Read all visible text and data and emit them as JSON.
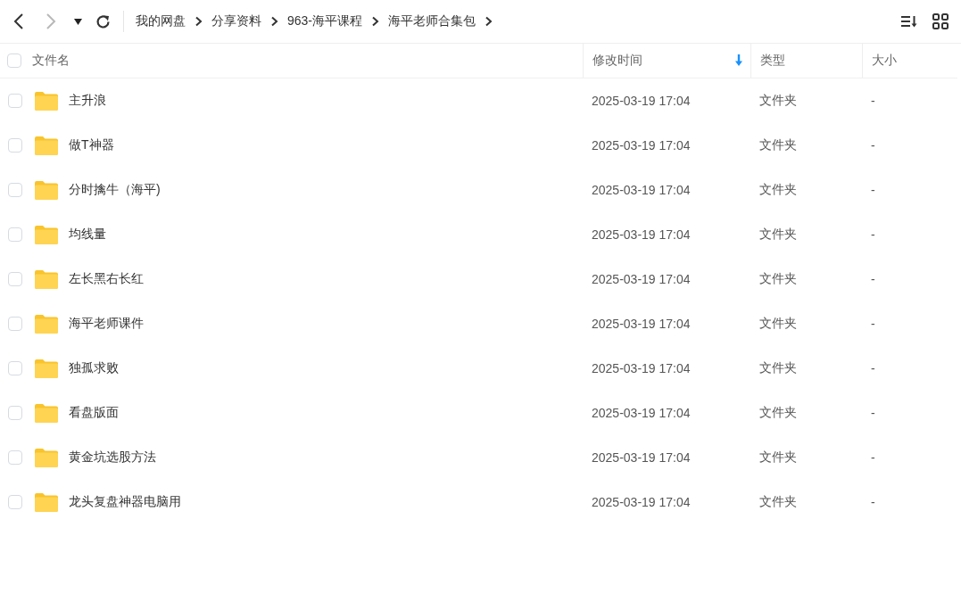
{
  "toolbar": {
    "back": {
      "disabled": false
    },
    "forward": {
      "disabled": true
    },
    "breadcrumbs": [
      "我的网盘",
      "分享资料",
      "963-海平课程",
      "海平老师合集包"
    ]
  },
  "table": {
    "select_all": {
      "checked": false
    },
    "columns": [
      {
        "label": "文件名",
        "sorted": false
      },
      {
        "label": "修改时间",
        "sorted": true
      },
      {
        "label": "类型",
        "sorted": false
      },
      {
        "label": "大小",
        "sorted": false
      }
    ],
    "rows": [
      {
        "name": "主升浪",
        "modified": "2025-03-19 17:04",
        "type": "文件夹",
        "size": "-",
        "checked": false
      },
      {
        "name": "做T神器",
        "modified": "2025-03-19 17:04",
        "type": "文件夹",
        "size": "-",
        "checked": false
      },
      {
        "name": "分时擒牛（海平)",
        "modified": "2025-03-19 17:04",
        "type": "文件夹",
        "size": "-",
        "checked": false
      },
      {
        "name": "均线量",
        "modified": "2025-03-19 17:04",
        "type": "文件夹",
        "size": "-",
        "checked": false
      },
      {
        "name": "左长黑右长红",
        "modified": "2025-03-19 17:04",
        "type": "文件夹",
        "size": "-",
        "checked": false
      },
      {
        "name": "海平老师课件",
        "modified": "2025-03-19 17:04",
        "type": "文件夹",
        "size": "-",
        "checked": false
      },
      {
        "name": "独孤求败",
        "modified": "2025-03-19 17:04",
        "type": "文件夹",
        "size": "-",
        "checked": false
      },
      {
        "name": "看盘版面",
        "modified": "2025-03-19 17:04",
        "type": "文件夹",
        "size": "-",
        "checked": false
      },
      {
        "name": "黄金坑选股方法",
        "modified": "2025-03-19 17:04",
        "type": "文件夹",
        "size": "-",
        "checked": false
      },
      {
        "name": "龙头复盘神器电脑用",
        "modified": "2025-03-19 17:04",
        "type": "文件夹",
        "size": "-",
        "checked": false
      }
    ]
  }
}
